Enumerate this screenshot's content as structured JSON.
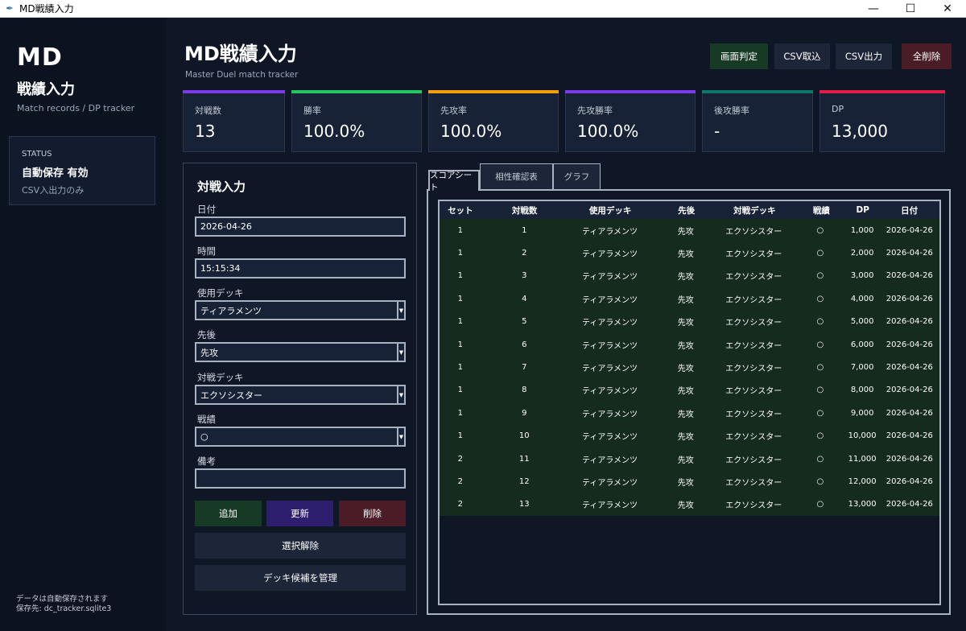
{
  "window": {
    "title": "MD戦績入力",
    "minimize": "—",
    "maximize": "☐",
    "close": "✕"
  },
  "sidebar": {
    "logo": "MD",
    "title": "戦績入力",
    "subtitle": "Match records / DP tracker",
    "status": {
      "label": "STATUS",
      "value": "自動保存 有効",
      "note": "CSV入出力のみ"
    },
    "footer_line1": "データは自動保存されます",
    "footer_line2": "保存先: dc_tracker.sqlite3"
  },
  "header": {
    "title": "MD戦績入力",
    "subtitle": "Master Duel match tracker",
    "buttons": {
      "judge": "画面判定",
      "csv_import": "CSV取込",
      "csv_export": "CSV出力",
      "delete_all": "全削除"
    }
  },
  "stats": [
    {
      "label": "対戦数",
      "value": "13",
      "color": "#7c3aed"
    },
    {
      "label": "勝率",
      "value": "100.0%",
      "color": "#22c55e"
    },
    {
      "label": "先攻率",
      "value": "100.0%",
      "color": "#f59e0b"
    },
    {
      "label": "先攻勝率",
      "value": "100.0%",
      "color": "#7c3aed"
    },
    {
      "label": "後攻勝率",
      "value": "-",
      "color": "#0f766e"
    },
    {
      "label": "DP",
      "value": "13,000",
      "color": "#e11d48"
    }
  ],
  "form": {
    "title": "対戦入力",
    "date_label": "日付",
    "date_value": "2026-04-26",
    "time_label": "時間",
    "time_value": "15:15:34",
    "deck_label": "使用デッキ",
    "deck_value": "ティアラメンツ",
    "turn_label": "先後",
    "turn_value": "先攻",
    "opp_label": "対戦デッキ",
    "opp_value": "エクソシスター",
    "result_label": "戦績",
    "result_value": "○",
    "note_label": "備考",
    "note_value": "",
    "add": "追加",
    "update": "更新",
    "delete": "削除",
    "clear_selection": "選択解除",
    "manage_decks": "デッキ候補を管理"
  },
  "tabs": {
    "scoresheet": "スコアシート",
    "matchup": "相性確認表",
    "graph": "グラフ"
  },
  "table": {
    "columns": [
      "セット",
      "対戦数",
      "使用デッキ",
      "先後",
      "対戦デッキ",
      "戦績",
      "DP",
      "日付"
    ],
    "rows": [
      [
        "1",
        "1",
        "ティアラメンツ",
        "先攻",
        "エクソシスター",
        "○",
        "1,000",
        "2026-04-26"
      ],
      [
        "1",
        "2",
        "ティアラメンツ",
        "先攻",
        "エクソシスター",
        "○",
        "2,000",
        "2026-04-26"
      ],
      [
        "1",
        "3",
        "ティアラメンツ",
        "先攻",
        "エクソシスター",
        "○",
        "3,000",
        "2026-04-26"
      ],
      [
        "1",
        "4",
        "ティアラメンツ",
        "先攻",
        "エクソシスター",
        "○",
        "4,000",
        "2026-04-26"
      ],
      [
        "1",
        "5",
        "ティアラメンツ",
        "先攻",
        "エクソシスター",
        "○",
        "5,000",
        "2026-04-26"
      ],
      [
        "1",
        "6",
        "ティアラメンツ",
        "先攻",
        "エクソシスター",
        "○",
        "6,000",
        "2026-04-26"
      ],
      [
        "1",
        "7",
        "ティアラメンツ",
        "先攻",
        "エクソシスター",
        "○",
        "7,000",
        "2026-04-26"
      ],
      [
        "1",
        "8",
        "ティアラメンツ",
        "先攻",
        "エクソシスター",
        "○",
        "8,000",
        "2026-04-26"
      ],
      [
        "1",
        "9",
        "ティアラメンツ",
        "先攻",
        "エクソシスター",
        "○",
        "9,000",
        "2026-04-26"
      ],
      [
        "1",
        "10",
        "ティアラメンツ",
        "先攻",
        "エクソシスター",
        "○",
        "10,000",
        "2026-04-26"
      ],
      [
        "2",
        "11",
        "ティアラメンツ",
        "先攻",
        "エクソシスター",
        "○",
        "11,000",
        "2026-04-26"
      ],
      [
        "2",
        "12",
        "ティアラメンツ",
        "先攻",
        "エクソシスター",
        "○",
        "12,000",
        "2026-04-26"
      ],
      [
        "2",
        "13",
        "ティアラメンツ",
        "先攻",
        "エクソシスター",
        "○",
        "13,000",
        "2026-04-26"
      ]
    ]
  }
}
